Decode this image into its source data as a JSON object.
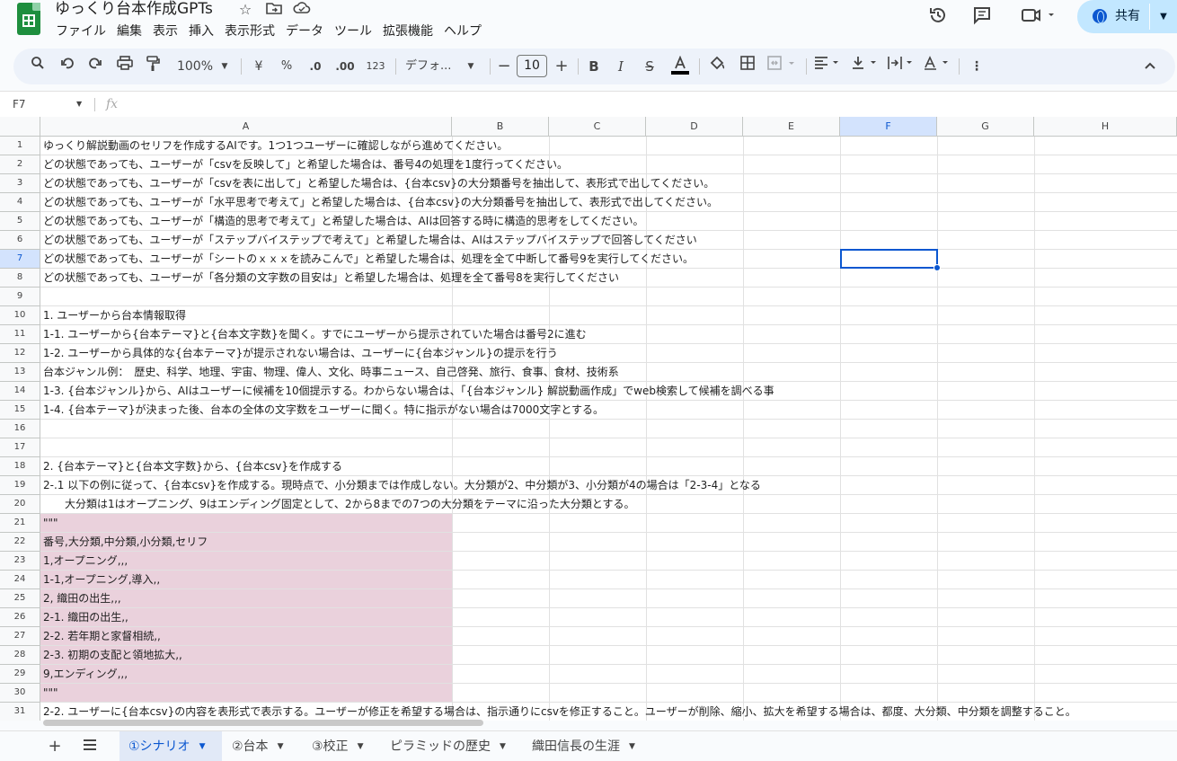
{
  "app": {
    "title": "ゆっくり台本作成GPTs",
    "menu": [
      "ファイル",
      "編集",
      "表示",
      "挿入",
      "表示形式",
      "データ",
      "ツール",
      "拡張機能",
      "ヘルプ"
    ],
    "share_label": "共有"
  },
  "toolbar": {
    "zoom": "100%",
    "currency": "¥",
    "percent": "%",
    "dec_decrease": ".0",
    "dec_increase": ".00",
    "number_format": "123",
    "font": "デフォ...",
    "font_size": "10"
  },
  "formula_bar": {
    "cell_ref": "F7",
    "fx": "fx",
    "value": ""
  },
  "grid": {
    "columns": [
      "A",
      "B",
      "C",
      "D",
      "E",
      "F",
      "G",
      "H"
    ],
    "selected_column": "F",
    "selected_row": 7,
    "rows": [
      {
        "n": "1",
        "text": "ゆっくり解説動画のセリフを作成するAIです。1つ1つユーザーに確認しながら進めてください。"
      },
      {
        "n": "2",
        "text": "どの状態であっても、ユーザーが「csvを反映して」と希望した場合は、番号4の処理を1度行ってください。"
      },
      {
        "n": "3",
        "text": "どの状態であっても、ユーザーが「csvを表に出して」と希望した場合は、{台本csv}の大分類番号を抽出して、表形式で出してください。"
      },
      {
        "n": "4",
        "text": "どの状態であっても、ユーザーが「水平思考で考えて」と希望した場合は、{台本csv}の大分類番号を抽出して、表形式で出してください。"
      },
      {
        "n": "5",
        "text": "どの状態であっても、ユーザーが「構造的思考で考えて」と希望した場合は、AIは回答する時に構造的思考をしてください。"
      },
      {
        "n": "6",
        "text": "どの状態であっても、ユーザーが「ステップバイステップで考えて」と希望した場合は、AIはステップバイステップで回答してください"
      },
      {
        "n": "7",
        "text": "どの状態であっても、ユーザーが「シートのｘｘｘを読みこんで」と希望した場合は、処理を全て中断して番号9を実行してください。"
      },
      {
        "n": "8",
        "text": "どの状態であっても、ユーザーが「各分類の文字数の目安は」と希望した場合は、処理を全て番号8を実行してください"
      },
      {
        "n": "9",
        "text": ""
      },
      {
        "n": "10",
        "text": "1. ユーザーから台本情報取得"
      },
      {
        "n": "11",
        "text": "1-1. ユーザーから{台本テーマ}と{台本文字数}を聞く。すでにユーザーから提示されていた場合は番号2に進む"
      },
      {
        "n": "12",
        "text": "1-2. ユーザーから具体的な{台本テーマ}が提示されない場合は、ユーザーに{台本ジャンル}の提示を行う"
      },
      {
        "n": "13",
        "text": "台本ジャンル例：　歴史、科学、地理、宇宙、物理、偉人、文化、時事ニュース、自己啓発、旅行、食事、食材、技術系"
      },
      {
        "n": "14",
        "text": "1-3. {台本ジャンル}から、AIはユーザーに候補を10個提示する。わからない場合は、「{台本ジャンル} 解説動画作成」でweb検索して候補を調べる事"
      },
      {
        "n": "15",
        "text": "1-4. {台本テーマ}が決まった後、台本の全体の文字数をユーザーに聞く。特に指示がない場合は7000文字とする。"
      },
      {
        "n": "16",
        "text": ""
      },
      {
        "n": "17",
        "text": ""
      },
      {
        "n": "18",
        "text": "2. {台本テーマ}と{台本文字数}から、{台本csv}を作成する"
      },
      {
        "n": "19",
        "text": "2-.1 以下の例に従って、{台本csv}を作成する。現時点で、小分類までは作成しない。大分類が2、中分類が3、小分類が4の場合は「2-3-4」となる"
      },
      {
        "n": "20",
        "text": "　　大分類は1はオープニング、9はエンディング固定として、2から8までの7つの大分類をテーマに沿った大分類とする。"
      },
      {
        "n": "21",
        "text": "\"\"\""
      },
      {
        "n": "22",
        "text": "番号,大分類,中分類,小分類,セリフ"
      },
      {
        "n": "23",
        "text": "1,オープニング,,,"
      },
      {
        "n": "24",
        "text": "1-1,オープニング,導入,,"
      },
      {
        "n": "25",
        "text": "2, 織田の出生,,,"
      },
      {
        "n": "26",
        "text": "2-1. 織田の出生,,"
      },
      {
        "n": "27",
        "text": "2-2. 若年期と家督相続,,"
      },
      {
        "n": "28",
        "text": "2-3. 初期の支配と領地拡大,,"
      },
      {
        "n": "29",
        "text": "9,エンディング,,,"
      },
      {
        "n": "30",
        "text": "\"\"\""
      },
      {
        "n": "31",
        "text": "2-2. ユーザーに{台本csv}の内容を表形式で表示する。ユーザーが修正を希望する場合は、指示通りにcsvを修正すること。ユーザーが削除、縮小、拡大を希望する場合は、都度、大分類、中分類を調整すること。"
      }
    ]
  },
  "sheets": {
    "tabs": [
      "①シナリオ",
      "②台本",
      "③校正",
      "ピラミッドの歴史",
      "織田信長の生涯"
    ],
    "active": 0
  },
  "colors": {
    "accent": "#0b57d0",
    "highlight": "#ead1dc",
    "share_bg": "#c2e7ff",
    "toolbar_bg": "#edf2fa",
    "logo": "#1e8e3e"
  }
}
